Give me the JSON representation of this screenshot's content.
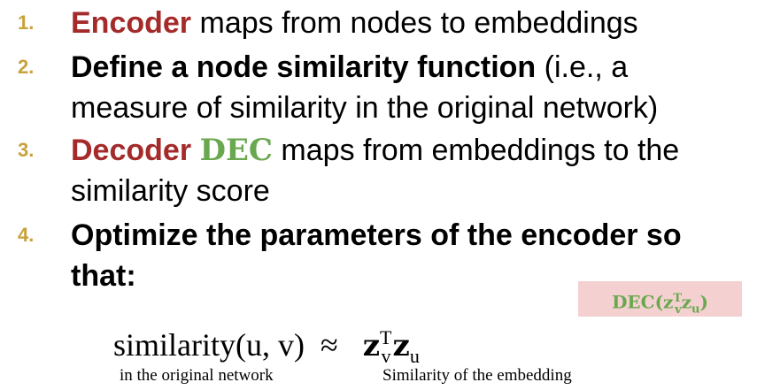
{
  "items": [
    {
      "number": "1.",
      "lead": "Encoder",
      "rest": " maps from nodes to embeddings"
    },
    {
      "number": "2.",
      "lead": "Define a node similarity function",
      "rest": " (i.e., a",
      "line2": "measure of similarity in the original network)"
    },
    {
      "number": "3.",
      "lead": "Decoder",
      "dec": "DEC",
      "rest": " maps from embeddings to the",
      "line2": "similarity score"
    },
    {
      "number": "4.",
      "line1": "Optimize the parameters of the encoder so",
      "line2": "that:"
    }
  ],
  "dec_box": {
    "prefix": "DEC(",
    "z": "z",
    "v_sub": "v",
    "t_sup": "T",
    "z2": "z",
    "u_sub": "u",
    "suffix": ")"
  },
  "formula": {
    "lhs": "similarity(u, v)",
    "approx": "≈",
    "z": "z",
    "v_sub": "v",
    "t_sup": "T",
    "z2": "z",
    "u_sub": "u"
  },
  "captions": {
    "left": "in the original network",
    "right": "Similarity of the embedding"
  },
  "colors": {
    "number": "#c9a13a",
    "accent_red": "#a52a2a",
    "accent_green": "#6aa84f",
    "box_bg": "#f4d0d0"
  }
}
